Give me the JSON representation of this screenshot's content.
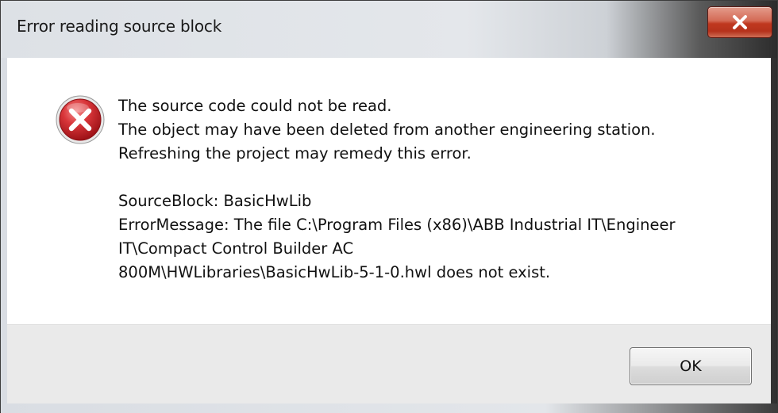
{
  "window": {
    "title": "Error reading source block",
    "close_symbol": "✕",
    "icon": "error-icon"
  },
  "message": {
    "lines": [
      "The source code could not be read.",
      "The object may have been deleted from another engineering station.",
      "Refreshing the project may remedy this error."
    ],
    "details": [
      "SourceBlock: BasicHwLib",
      "ErrorMessage: The file C:\\Program Files (x86)\\ABB Industrial IT\\Engineer",
      "IT\\Compact Control Builder AC",
      "800M\\HWLibraries\\BasicHwLib-5-1-0.hwl does not exist."
    ]
  },
  "buttons": {
    "ok_label": "OK"
  },
  "colors": {
    "close_button": "#c0381f",
    "icon_red": "#c8202a",
    "content_bg": "#ffffff",
    "footer_bg": "#eaeaea"
  }
}
